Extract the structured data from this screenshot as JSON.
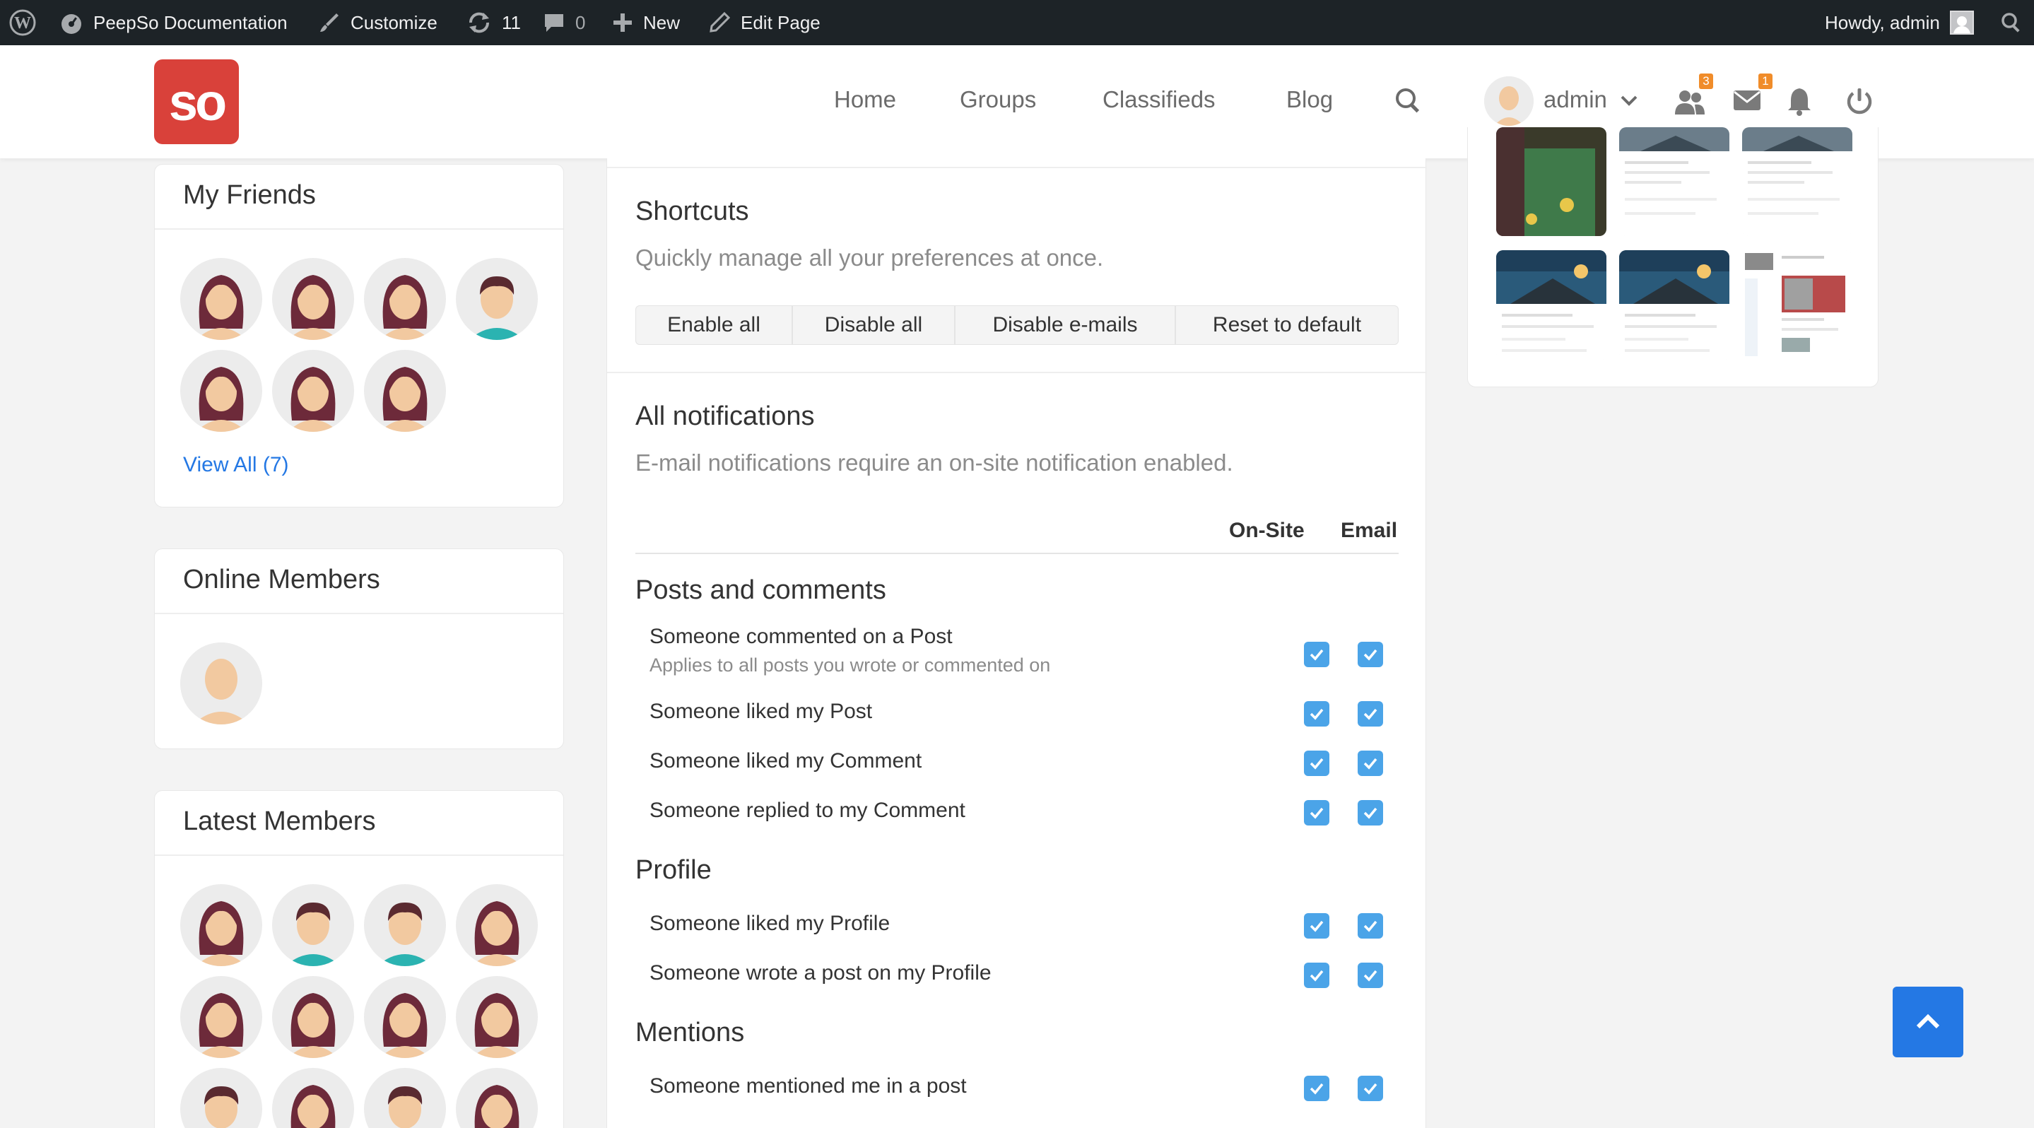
{
  "adminbar": {
    "site_name": "PeepSo Documentation",
    "customize": "Customize",
    "updates_count": "11",
    "comments_count": "0",
    "new_label": "New",
    "edit_page": "Edit Page",
    "howdy": "Howdy, admin"
  },
  "header": {
    "logo_text": "so",
    "nav": [
      "Home",
      "Groups",
      "Classifieds",
      "Blog"
    ],
    "user_name": "admin",
    "friends_badge": "3",
    "messages_badge": "1"
  },
  "sidebar": {
    "my_friends": {
      "title": "My Friends",
      "view_all": "View All (7)"
    },
    "online_members": {
      "title": "Online Members"
    },
    "latest_members": {
      "title": "Latest Members"
    }
  },
  "main": {
    "shortcuts_title": "Shortcuts",
    "shortcuts_sub": "Quickly manage all your preferences at once.",
    "buttons": [
      "Enable all",
      "Disable all",
      "Disable e-mails",
      "Reset to default"
    ],
    "all_title": "All notifications",
    "all_sub": "E-mail notifications require an on-site notification enabled.",
    "col_onsite": "On-Site",
    "col_email": "Email",
    "sections": {
      "posts": "Posts and comments",
      "profile": "Profile",
      "mentions": "Mentions"
    },
    "rows": {
      "commented": "Someone commented on a Post",
      "commented_hint": "Applies to all posts you wrote or commented on",
      "liked_post": "Someone liked my Post",
      "liked_comment": "Someone liked my Comment",
      "replied": "Someone replied to my Comment",
      "liked_profile": "Someone liked my Profile",
      "wrote_profile": "Someone wrote a post on my Profile",
      "mentioned": "Someone mentioned me in a post"
    }
  },
  "colors": {
    "accent": "#2478e4",
    "checkbox": "#4ba4e8",
    "logo": "#d9413a",
    "badge": "#f08c2a"
  }
}
